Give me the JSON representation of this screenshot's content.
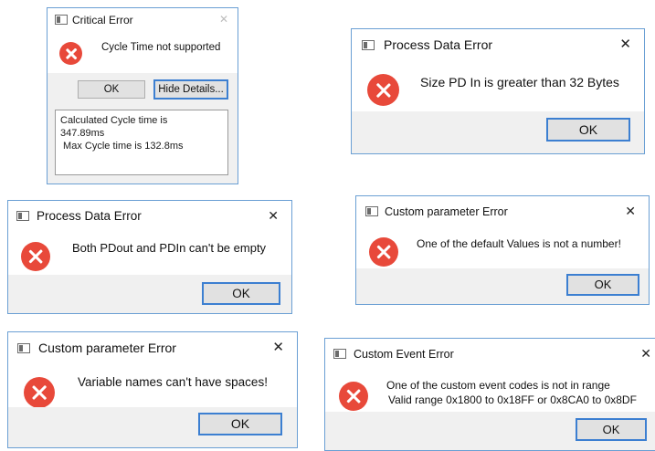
{
  "dialogs": {
    "critical": {
      "title": "Critical Error",
      "close": "✕",
      "message": "Cycle Time not supported",
      "ok_label": "OK",
      "details_button_label": "Hide Details...",
      "details_lines": [
        "Calculated Cycle time is",
        "347.89ms",
        " Max Cycle time is 132.8ms"
      ]
    },
    "pd_size": {
      "title": "Process Data Error",
      "close": "✕",
      "message": "Size PD In is greater than 32 Bytes",
      "ok_label": "OK"
    },
    "pd_empty": {
      "title": "Process Data Error",
      "close": "✕",
      "message": "Both PDout and PDIn can't be empty",
      "ok_label": "OK"
    },
    "custom_default": {
      "title": "Custom parameter Error",
      "close": "✕",
      "message": "One of the default Values is not a number!",
      "ok_label": "OK"
    },
    "custom_spaces": {
      "title": "Custom parameter Error",
      "close": "✕",
      "message": "Variable names can't have spaces!",
      "ok_label": "OK"
    },
    "custom_event": {
      "title": "Custom Event Error",
      "close": "✕",
      "message_line1": "One of the custom event codes is not in range",
      "message_line2": "Valid range 0x1800 to 0x18FF or 0x8CA0 to 0x8DF",
      "ok_label": "OK"
    }
  },
  "colors": {
    "error_icon": "#e8493a",
    "window_border": "#6a9fd4",
    "button_default_border": "#3c7fd1",
    "footer_bg": "#f0f0f0"
  }
}
